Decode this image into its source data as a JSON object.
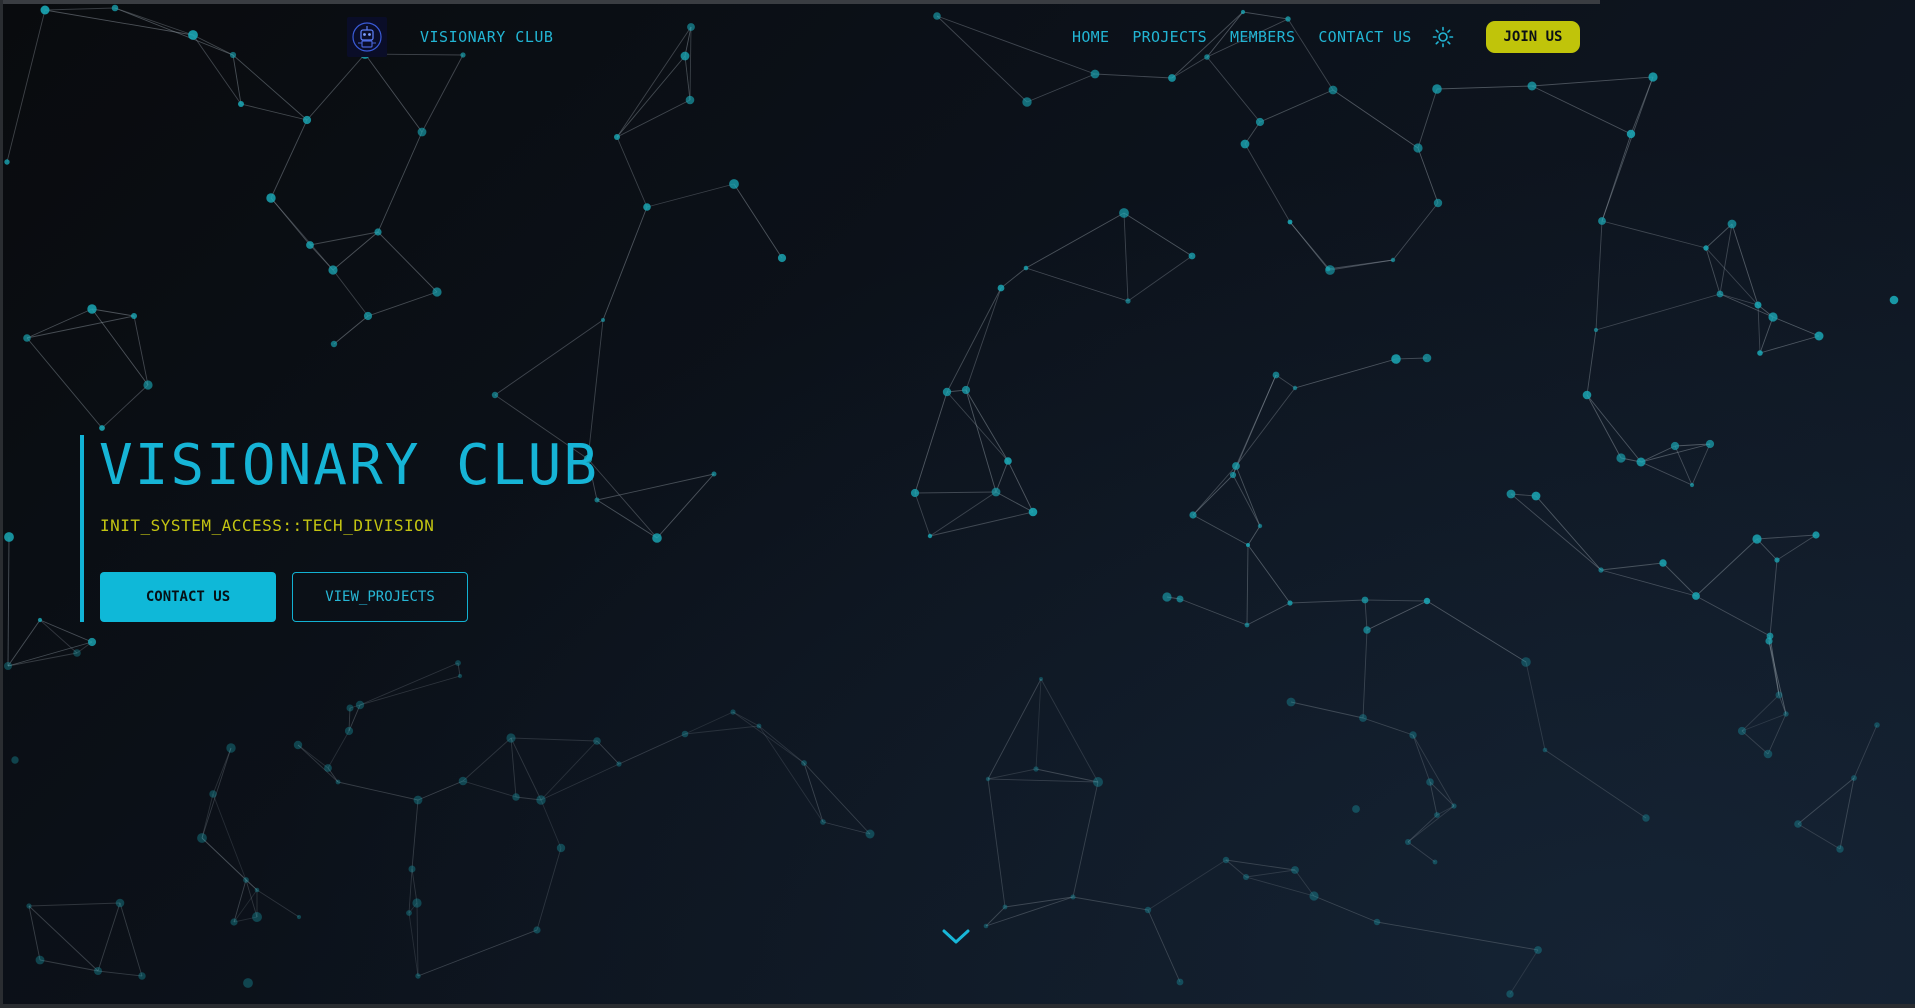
{
  "brand": {
    "name": "VISIONARY CLUB",
    "logo_icon": "robot-logo-icon"
  },
  "nav": {
    "items": [
      {
        "label": "HOME"
      },
      {
        "label": "PROJECTS"
      },
      {
        "label": "MEMBERS"
      },
      {
        "label": "CONTACT US"
      }
    ],
    "theme_toggle_icon": "sun-icon",
    "join_label": "JOIN US"
  },
  "hero": {
    "title": "VISIONARY CLUB",
    "subtitle": "INIT_SYSTEM_ACCESS::TECH_DIVISION",
    "primary_button": "CONTACT US",
    "secondary_button": "VIEW_PROJECTS",
    "scroll_icon": "chevron-down-icon"
  },
  "colors": {
    "accent": "#16b4d6",
    "highlight": "#c0c40a",
    "background": "#0b0f16",
    "network_node": "#1aa7b5",
    "network_line": "#9aa4ad"
  },
  "background_graphic": "particle-network-icon"
}
